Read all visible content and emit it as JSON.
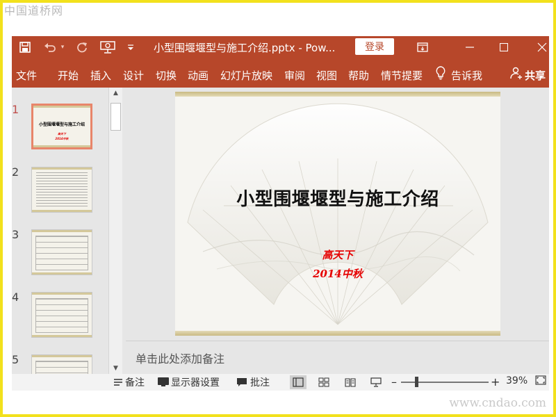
{
  "watermark_top": "中国道桥网",
  "watermark_bottom": "www.cndao.com",
  "titlebar": {
    "icons": [
      "save-icon",
      "undo-icon",
      "redo-icon",
      "present-from-start-icon",
      "customize-qat-icon"
    ],
    "title": "小型围堰堰型与施工介绍.pptx  -  Pow...",
    "login_label": "登录",
    "ribbon_display_icon": "ribbon-display-options-icon",
    "minimize_icon": "minimize-icon",
    "maximize_icon": "maximize-icon",
    "close_icon": "close-icon"
  },
  "ribbon": {
    "tabs": [
      "文件",
      "开始",
      "插入",
      "设计",
      "切换",
      "动画",
      "幻灯片放映",
      "审阅",
      "视图",
      "帮助",
      "情节提要"
    ],
    "tell_me": "告诉我",
    "tell_me_icon": "lightbulb-icon",
    "share": "共享",
    "share_icon": "share-user-icon"
  },
  "thumbnails": {
    "numbers": [
      "1",
      "2",
      "3",
      "4",
      "5"
    ],
    "slide1_title": "小型围堰堰型与施工介绍",
    "slide1_author": "高天下",
    "slide1_date": "2014中秋"
  },
  "slide": {
    "title": "小型围堰堰型与施工介绍",
    "author": "高天下",
    "date": "2014中秋"
  },
  "notes": {
    "placeholder": "单击此处添加备注"
  },
  "status": {
    "notes_label": "备注",
    "display_settings_label": "显示器设置",
    "comments_label": "批注",
    "zoom_minus": "–",
    "zoom_plus": "+",
    "zoom_level": "39%",
    "zoom_fraction": 0.39,
    "active_view": "normal"
  },
  "colors": {
    "accent": "#b7472a",
    "active_thumb_border": "#e8856a",
    "slide_subtitle": "#e60000"
  }
}
